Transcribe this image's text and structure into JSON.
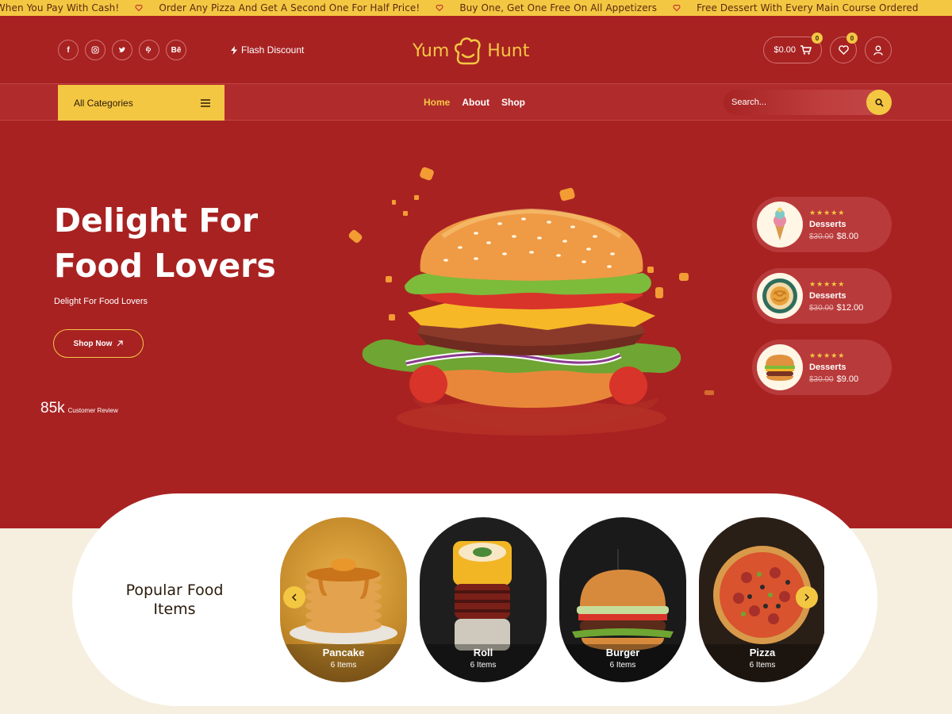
{
  "ticker": [
    "al When You Pay With Cash!",
    "Order Any Pizza And Get A Second One For Half Price!",
    "Buy One, Get One Free On All Appetizers",
    "Free Dessert With Every Main Course Ordered"
  ],
  "header": {
    "socials": [
      "f",
      "ig",
      "tw",
      "p",
      "Bē"
    ],
    "flash_label": "Flash Discount",
    "logo_left": "Yum",
    "logo_right": "Hunt",
    "cart_total": "$0.00",
    "cart_count": "0",
    "wishlist_count": "0"
  },
  "nav": {
    "categories_label": "All Categories",
    "links": [
      "Home",
      "About",
      "Shop"
    ],
    "search_placeholder": "Search..."
  },
  "hero": {
    "title_line1": "Delight For",
    "title_line2": "Food Lovers",
    "subtitle": "Delight For Food Lovers",
    "cta": "Shop Now",
    "review_count": "85k",
    "review_label": "Customer Review"
  },
  "side_items": [
    {
      "name": "Desserts",
      "old_price": "$30.00",
      "price": "$8.00",
      "rating": 5,
      "icon": "ice-cream"
    },
    {
      "name": "Desserts",
      "old_price": "$30.00",
      "price": "$12.00",
      "rating": 5,
      "icon": "pasta"
    },
    {
      "name": "Desserts",
      "old_price": "$30.00",
      "price": "$9.00",
      "rating": 5,
      "icon": "burger"
    }
  ],
  "popular": {
    "title": "Popular Food Items",
    "items": [
      {
        "name": "Pancake",
        "count": "6 Items"
      },
      {
        "name": "Roll",
        "count": "6 Items"
      },
      {
        "name": "Burger",
        "count": "6 Items"
      },
      {
        "name": "Pizza",
        "count": "6 Items"
      }
    ]
  },
  "colors": {
    "primary": "#a82222",
    "accent": "#f4c743",
    "cream": "#f6efe0"
  }
}
